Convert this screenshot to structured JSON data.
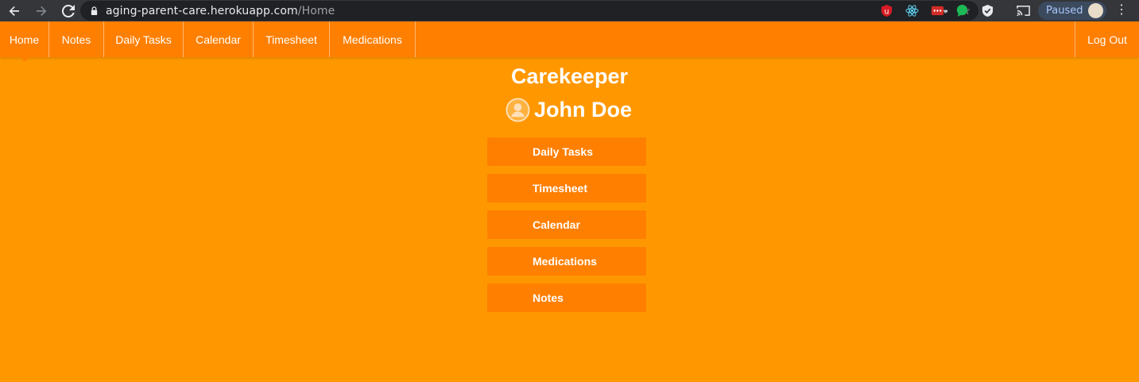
{
  "browser": {
    "url_host": "aging-parent-care.herokuapp.com",
    "url_path": "/Home",
    "profile_status": "Paused"
  },
  "nav": {
    "items": [
      {
        "label": "Home",
        "active": true
      },
      {
        "label": "Notes"
      },
      {
        "label": "Daily Tasks"
      },
      {
        "label": "Calendar"
      },
      {
        "label": "Timesheet"
      },
      {
        "label": "Medications"
      }
    ],
    "logout_label": "Log Out"
  },
  "main": {
    "title": "Carekeeper",
    "user_name": "John Doe",
    "buttons": [
      {
        "label": "Daily Tasks"
      },
      {
        "label": "Timesheet"
      },
      {
        "label": "Calendar"
      },
      {
        "label": "Medications"
      },
      {
        "label": "Notes"
      }
    ]
  },
  "colors": {
    "background": "#ff9800",
    "nav_bar": "#ff7f00",
    "button": "#ff7f00"
  }
}
